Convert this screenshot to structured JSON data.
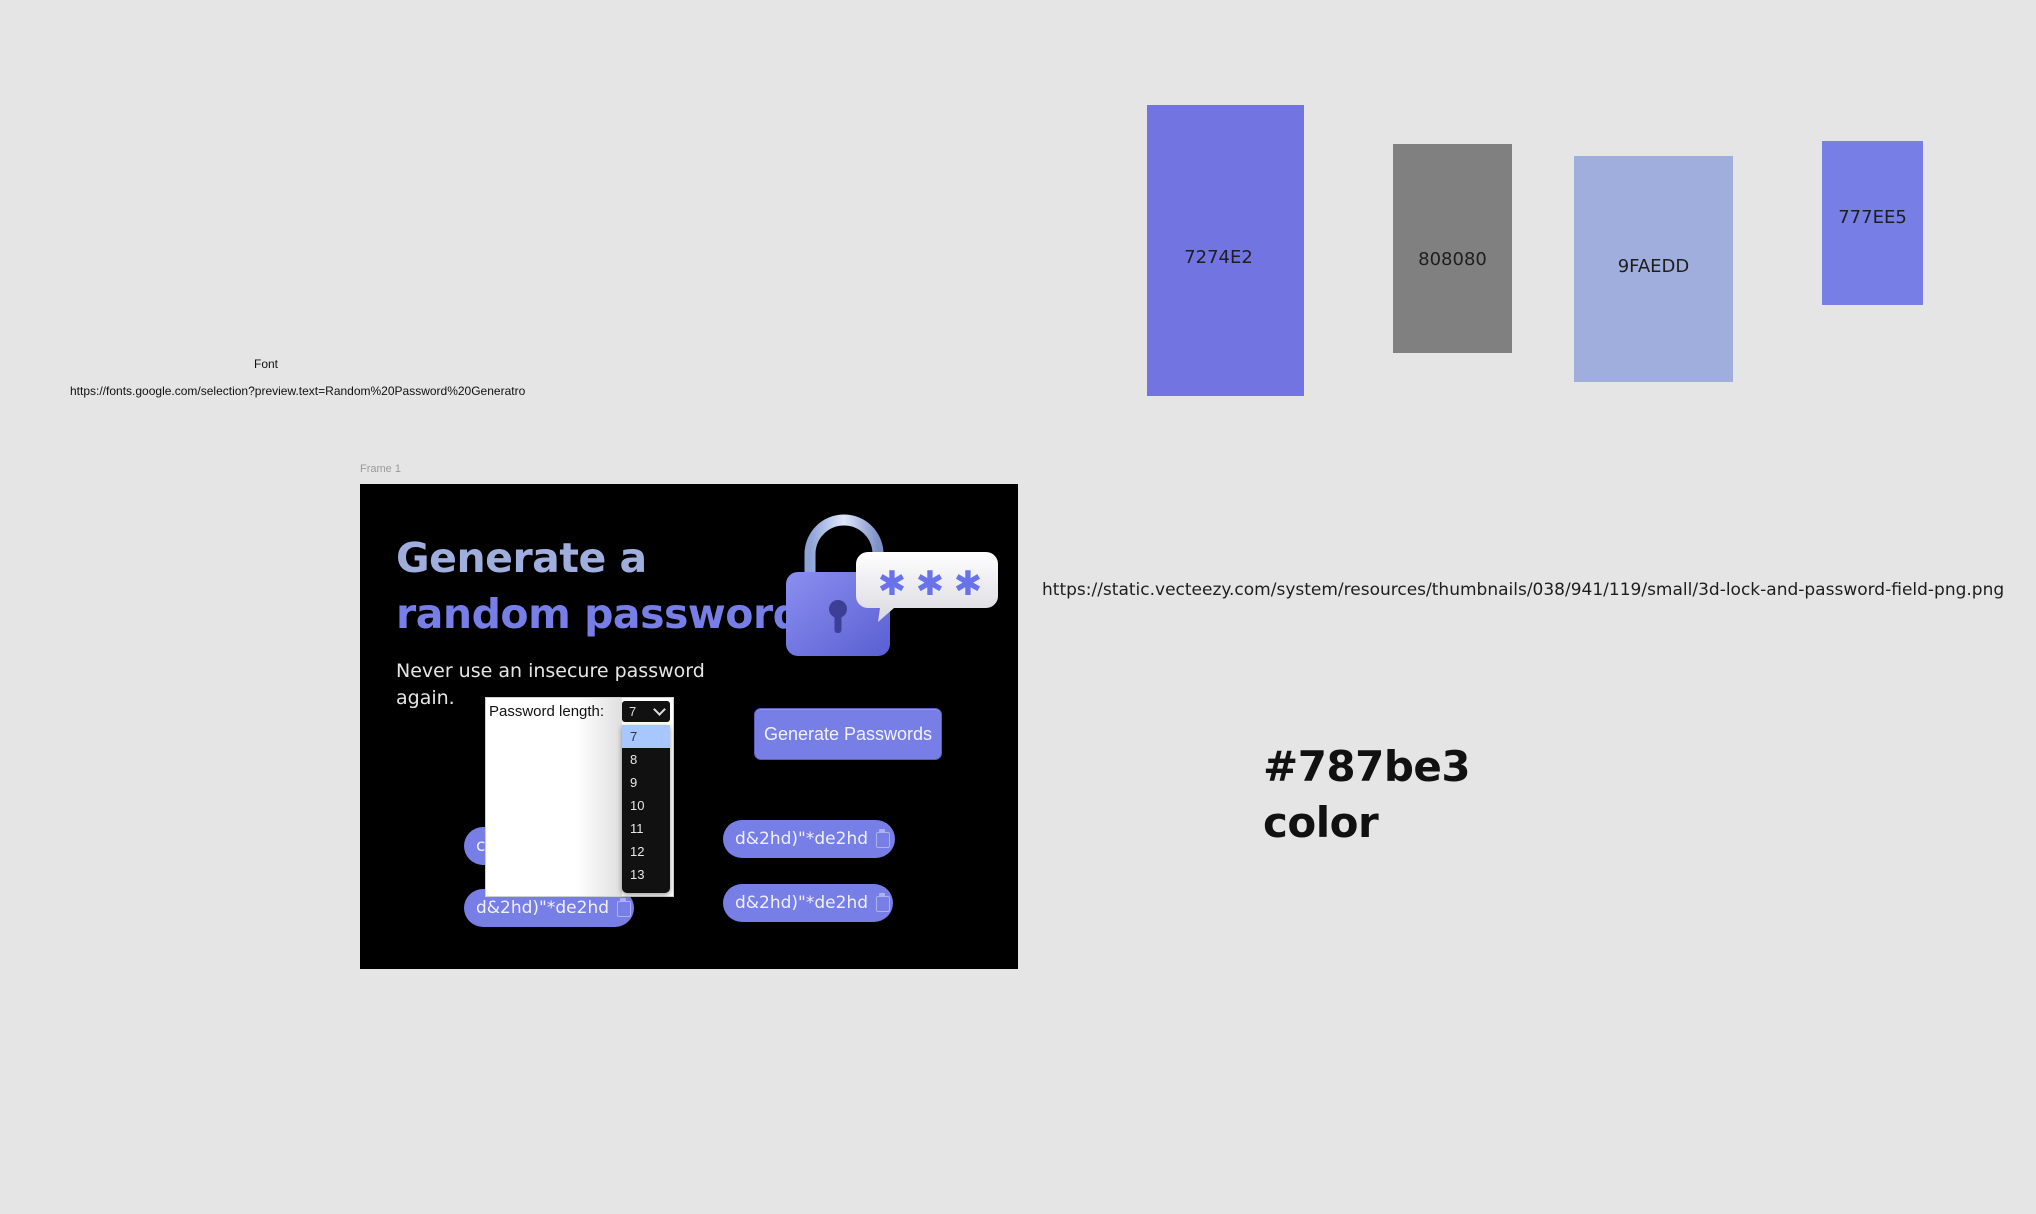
{
  "swatches": [
    {
      "label": "7274E2",
      "color": "#7274e2"
    },
    {
      "label": "808080",
      "color": "#808080"
    },
    {
      "label": "9FAEDD",
      "color": "#9faedd"
    },
    {
      "label": "777EE5",
      "color": "#777ee5"
    }
  ],
  "font_note": {
    "title": "Font",
    "url": "https://fonts.google.com/selection?preview.text=Random%20Password%20Generatro"
  },
  "image_url": "https://static.vecteezy.com/system/resources/thumbnails/038/941/119/small/3d-lock-and-password-field-png.png",
  "color_note": {
    "line1": "#787be3",
    "line2": "color"
  },
  "frame": {
    "label": "Frame 1",
    "title_line1": "Generate a",
    "title_line2": "random password",
    "subtitle": "Never use an insecure password again.",
    "generate_button": "Generate Passwords",
    "password_length_label": "Password length:",
    "selected_length": "7",
    "length_options": [
      "7",
      "8",
      "9",
      "10",
      "11",
      "12",
      "13"
    ],
    "passwords": [
      "d&2hd)\"*de2hd",
      "d&2hd)\"*de2hd",
      "d&2hd)\"*de2hd",
      "d&2hd)\"*de2hd"
    ],
    "hidden_pill_fragment": "c",
    "lock_asterisks": [
      "✱",
      "✱",
      "✱"
    ]
  },
  "colors": {
    "frame_bg": "#000000",
    "title_light": "#9faedd",
    "title_accent": "#777ee5",
    "pill": "#777ee5"
  }
}
